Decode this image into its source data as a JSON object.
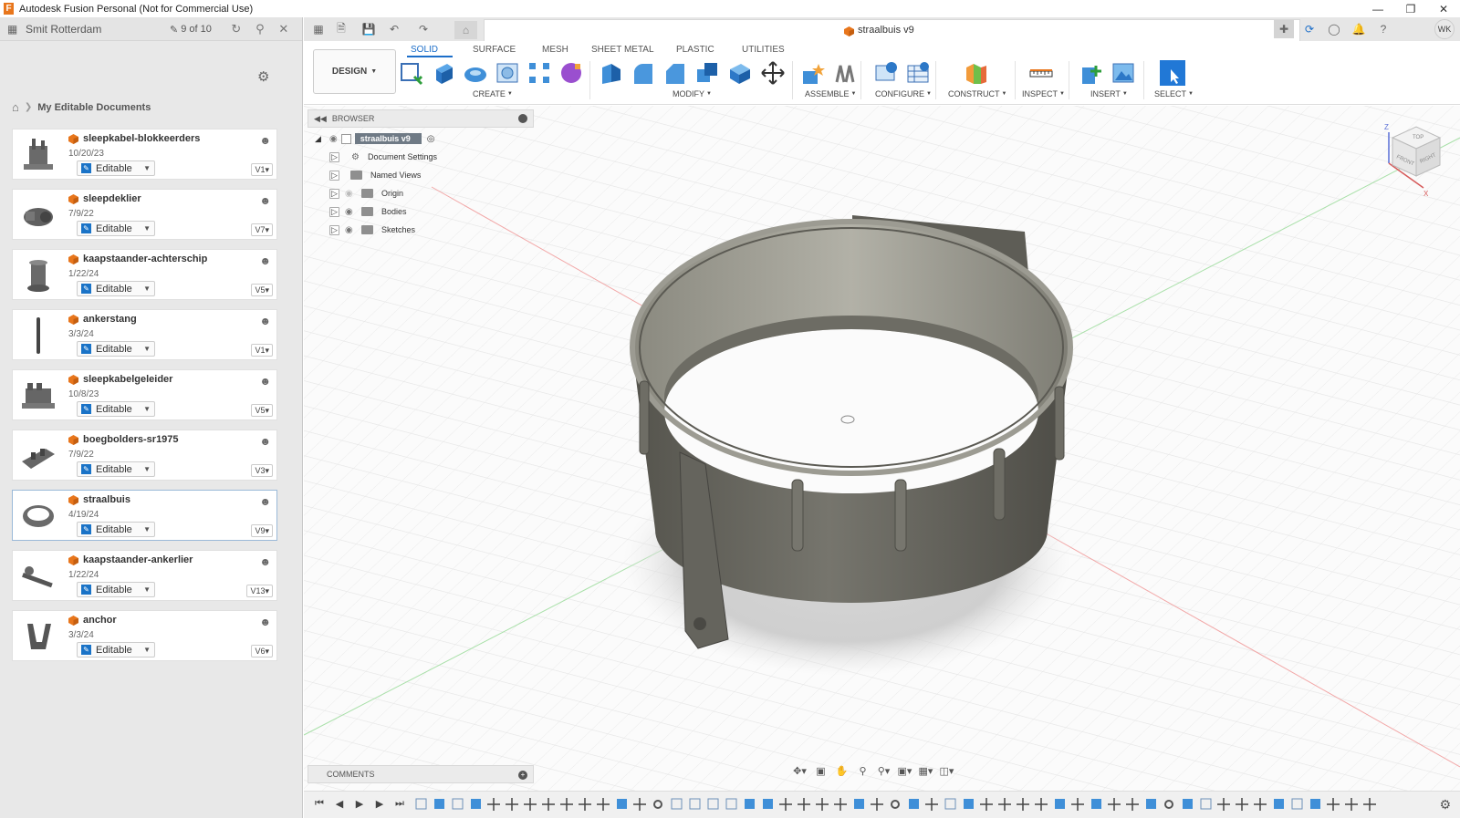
{
  "window": {
    "title": "Autodesk Fusion Personal (Not for Commercial Use)"
  },
  "data_panel": {
    "team_name": "Smit Rotterdam",
    "doc_count": "9 of 10",
    "breadcrumb": "My Editable Documents",
    "documents": [
      {
        "name": "sleepkabel-blokkeerders",
        "date": "10/20/23",
        "status": "Editable",
        "version": "V1"
      },
      {
        "name": "sleepdeklier",
        "date": "7/9/22",
        "status": "Editable",
        "version": "V7"
      },
      {
        "name": "kaapstaander-achterschip",
        "date": "1/22/24",
        "status": "Editable",
        "version": "V5"
      },
      {
        "name": "ankerstang",
        "date": "3/3/24",
        "status": "Editable",
        "version": "V1"
      },
      {
        "name": "sleepkabelgeleider",
        "date": "10/8/23",
        "status": "Editable",
        "version": "V5"
      },
      {
        "name": "boegbolders-sr1975",
        "date": "7/9/22",
        "status": "Editable",
        "version": "V3"
      },
      {
        "name": "straalbuis",
        "date": "4/19/24",
        "status": "Editable",
        "version": "V9"
      },
      {
        "name": "kaapstaander-ankerlier",
        "date": "1/22/24",
        "status": "Editable",
        "version": "V13"
      },
      {
        "name": "anchor",
        "date": "3/3/24",
        "status": "Editable",
        "version": "V6"
      }
    ]
  },
  "tab": {
    "title": "straalbuis v9",
    "avatar": "WK"
  },
  "toolbar": {
    "workspace": "DESIGN",
    "tabs": [
      "SOLID",
      "SURFACE",
      "MESH",
      "SHEET METAL",
      "PLASTIC",
      "UTILITIES"
    ],
    "groups": [
      "CREATE",
      "MODIFY",
      "ASSEMBLE",
      "CONFIGURE",
      "CONSTRUCT",
      "INSPECT",
      "INSERT",
      "SELECT"
    ]
  },
  "browser": {
    "title": "BROWSER",
    "root": "straalbuis v9",
    "items": [
      "Document Settings",
      "Named Views",
      "Origin",
      "Bodies",
      "Sketches"
    ]
  },
  "comments": {
    "title": "COMMENTS"
  },
  "viewcube": {
    "faces": [
      "TOP",
      "FRONT",
      "RIGHT"
    ],
    "axes": [
      "Z",
      "X"
    ]
  },
  "colors": {
    "accent": "#1c6ec9",
    "model": "#6b6a62",
    "badge": "#e8761c"
  }
}
